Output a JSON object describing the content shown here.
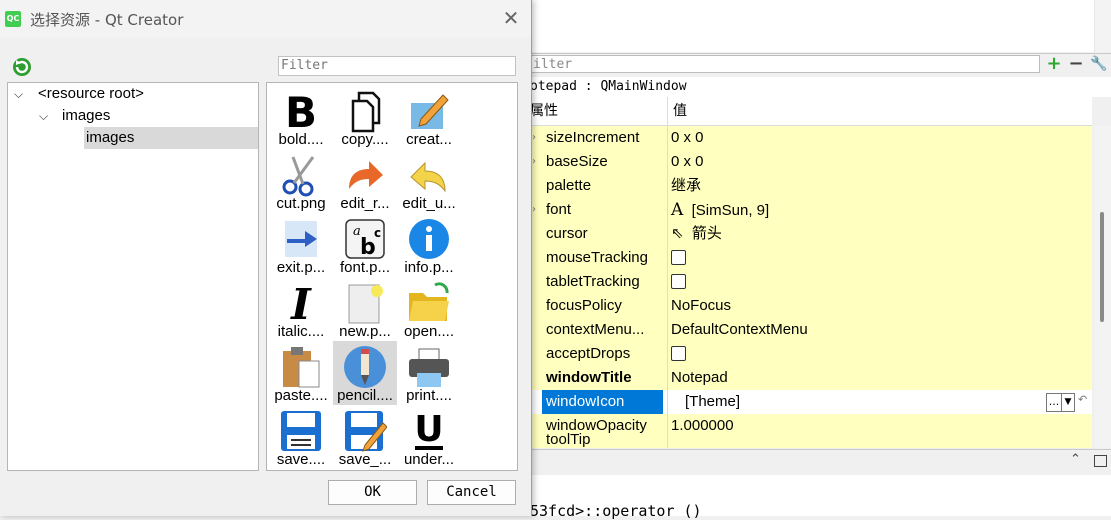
{
  "dialog": {
    "title": "选择资源 - Qt Creator",
    "logo_text": "QC",
    "filter_placeholder": "Filter",
    "ok_label": "OK",
    "cancel_label": "Cancel",
    "tree": {
      "root": "<resource root>",
      "child": "images",
      "grandchild": "images"
    },
    "icons": [
      {
        "label": "bold....",
        "icon": "bold-icon"
      },
      {
        "label": "copy....",
        "icon": "copy-icon"
      },
      {
        "label": "creat...",
        "icon": "create-icon"
      },
      {
        "label": "cut.png",
        "icon": "cut-icon"
      },
      {
        "label": "edit_r...",
        "icon": "redo-icon"
      },
      {
        "label": "edit_u...",
        "icon": "undo-icon"
      },
      {
        "label": "exit.p...",
        "icon": "exit-icon"
      },
      {
        "label": "font.p...",
        "icon": "font-icon"
      },
      {
        "label": "info.p...",
        "icon": "info-icon"
      },
      {
        "label": "italic....",
        "icon": "italic-icon"
      },
      {
        "label": "new.p...",
        "icon": "new-icon"
      },
      {
        "label": "open....",
        "icon": "open-icon"
      },
      {
        "label": "paste....",
        "icon": "paste-icon"
      },
      {
        "label": "pencil....",
        "icon": "pencil-icon"
      },
      {
        "label": "print....",
        "icon": "print-icon"
      },
      {
        "label": "save....",
        "icon": "save-icon"
      },
      {
        "label": "save_...",
        "icon": "save-as-icon"
      },
      {
        "label": "under...",
        "icon": "underline-icon"
      }
    ]
  },
  "property_editor": {
    "filter_placeholder": "ilter",
    "object_line": "otepad : QMainWindow",
    "header_property": "属性",
    "header_value": "值",
    "rows": [
      {
        "name": "sizeIncrement",
        "value": "0 x 0"
      },
      {
        "name": "baseSize",
        "value": "0 x 0"
      },
      {
        "name": "palette",
        "value": "继承"
      },
      {
        "name": "font",
        "value": "[SimSun, 9]",
        "prefix": "A"
      },
      {
        "name": "cursor",
        "value": "箭头",
        "prefix": "⇖"
      },
      {
        "name": "mouseTracking",
        "value": ""
      },
      {
        "name": "tabletTracking",
        "value": ""
      },
      {
        "name": "focusPolicy",
        "value": "NoFocus"
      },
      {
        "name": "contextMenu...",
        "value": "DefaultContextMenu"
      },
      {
        "name": "acceptDrops",
        "value": ""
      },
      {
        "name": "windowTitle",
        "value": "Notepad"
      },
      {
        "name": "windowIcon",
        "value": "[Theme]"
      },
      {
        "name": "windowOpacity",
        "value": "1.000000"
      },
      {
        "name": "toolTip",
        "value": ""
      }
    ],
    "code_line": "53fcd>::operator ()"
  },
  "colors": {
    "selection": "#0078d7",
    "property_row": "#ffffbf",
    "tree_selection": "#d9d9d9"
  }
}
